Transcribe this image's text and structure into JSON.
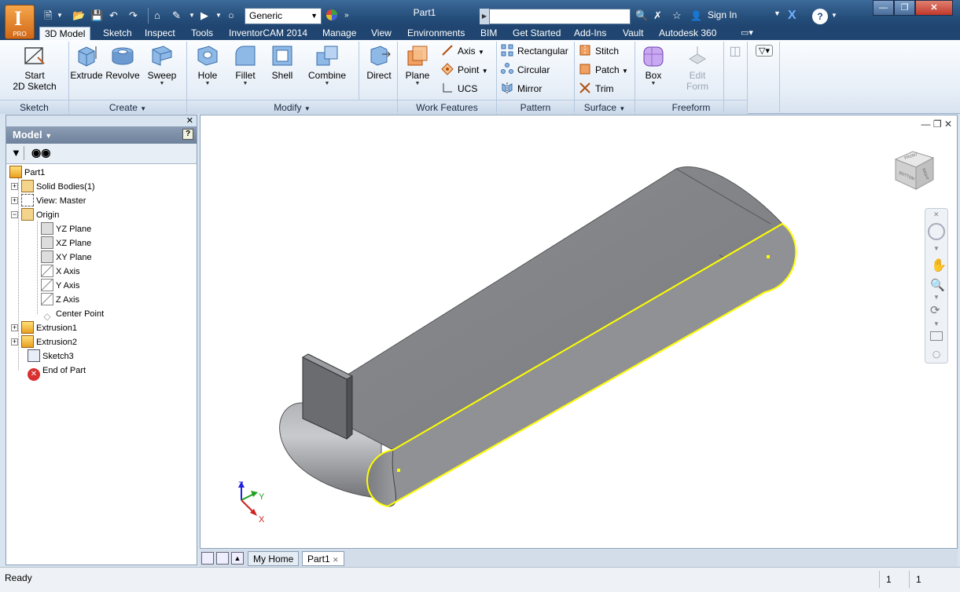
{
  "app": {
    "badge": "PRO",
    "document_title": "Part1",
    "material": "Generic",
    "sign_in": "Sign In"
  },
  "tabs": [
    "3D Model",
    "Sketch",
    "Inspect",
    "Tools",
    "InventorCAM 2014",
    "Manage",
    "View",
    "Environments",
    "BIM",
    "Get Started",
    "Add-Ins",
    "Vault",
    "Autodesk 360"
  ],
  "ribbon": {
    "sketch_panel": {
      "label": "Sketch",
      "start_sketch": "Start",
      "start_sketch_2": "2D Sketch"
    },
    "create_panel": {
      "label": "Create",
      "extrude": "Extrude",
      "revolve": "Revolve",
      "sweep": "Sweep"
    },
    "modify_panel": {
      "label": "Modify",
      "hole": "Hole",
      "fillet": "Fillet",
      "shell": "Shell",
      "combine": "Combine",
      "direct": "Direct"
    },
    "work_features_panel": {
      "label": "Work Features",
      "plane": "Plane",
      "axis": "Axis",
      "point": "Point",
      "ucs": "UCS"
    },
    "pattern_panel": {
      "label": "Pattern",
      "rectangular": "Rectangular",
      "circular": "Circular",
      "mirror": "Mirror"
    },
    "surface_panel": {
      "label": "Surface",
      "stitch": "Stitch",
      "patch": "Patch",
      "trim": "Trim"
    },
    "freeform_panel": {
      "label": "Freeform",
      "box": "Box",
      "edit_form": "Edit",
      "edit_form_2": "Form"
    }
  },
  "browser": {
    "title": "Model",
    "tree": [
      {
        "label": "Part1"
      },
      {
        "label": "Solid Bodies(1)"
      },
      {
        "label": "View: Master"
      },
      {
        "label": "Origin"
      },
      {
        "label": "YZ Plane"
      },
      {
        "label": "XZ Plane"
      },
      {
        "label": "XY Plane"
      },
      {
        "label": "X Axis"
      },
      {
        "label": "Y Axis"
      },
      {
        "label": "Z Axis"
      },
      {
        "label": "Center Point"
      },
      {
        "label": "Extrusion1"
      },
      {
        "label": "Extrusion2"
      },
      {
        "label": "Sketch3"
      },
      {
        "label": "End of Part"
      }
    ]
  },
  "viewport": {
    "axes": {
      "z": "Z",
      "y": "Y",
      "x": "X"
    },
    "viewcube": {
      "front": "FRONT",
      "right": "RIGHT",
      "bottom": "BOTTOM"
    },
    "accent_highlight": "#ffff00"
  },
  "doc_tabs": [
    "My Home",
    "Part1"
  ],
  "status": {
    "text": "Ready",
    "count1": "1",
    "count2": "1"
  }
}
